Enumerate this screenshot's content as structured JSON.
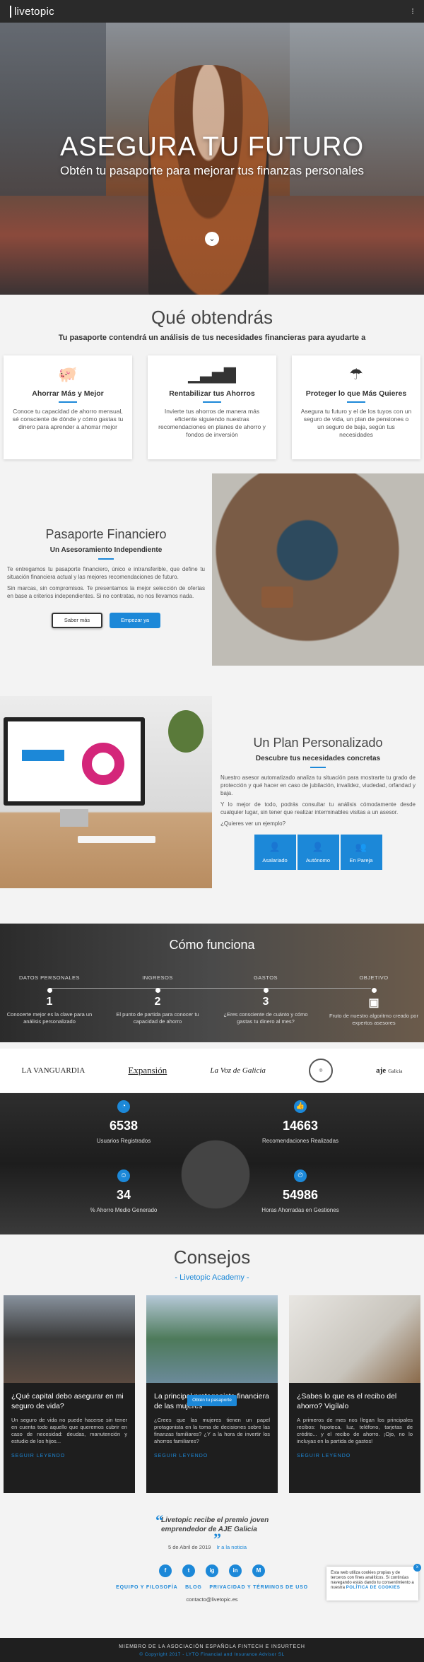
{
  "nav": {
    "logo": "livetopic",
    "menu_icon": "menu-icon"
  },
  "hero": {
    "title": "ASEGURA TU FUTURO",
    "subtitle": "Obtén tu pasaporte para mejorar tus finanzas personales"
  },
  "benefits": {
    "title": "Qué obtendrás",
    "subtitle": "Tu pasaporte contendrá un análisis de tus necesidades financieras para ayudarte a",
    "cards": [
      {
        "icon": "piggy-bank-icon",
        "title": "Ahorrar Más y Mejor",
        "text": "Conoce tu capacidad de ahorro mensual, sé consciente de dónde y cómo gastas tu dinero para aprender a ahorrar mejor"
      },
      {
        "icon": "bar-chart-icon",
        "title": "Rentabilizar tus Ahorros",
        "text": "Invierte tus ahorros de manera más eficiente siguiendo nuestras recomendaciones en planes de ahorro y fondos de inversión"
      },
      {
        "icon": "umbrella-icon",
        "title": "Proteger lo que Más Quieres",
        "text": "Asegura tu futuro y el de los tuyos con un seguro de vida, un plan de pensiones o un seguro de baja, según tus necesidades"
      }
    ]
  },
  "passport": {
    "title": "Pasaporte Financiero",
    "subtitle": "Un Asesoramiento Independiente",
    "p1": "Te entregamos tu pasaporte financiero, único e intransferible, que define tu situación financiera actual y las mejores recomendaciones de futuro.",
    "p2": "Sin marcas, sin compromisos. Te presentamos la mejor selección de ofertas en base a criterios independientes. Si no contratas, no nos llevamos nada.",
    "btn_more": "Saber más",
    "btn_start": "Empezar ya"
  },
  "plan": {
    "title": "Un Plan Personalizado",
    "subtitle": "Descubre tus necesidades concretas",
    "p1": "Nuestro asesor automatizado analiza tu situación para mostrarte tu grado de protección y qué hacer en caso de jubilación, invalidez, viudedad, orfandad y baja.",
    "p2": "Y lo mejor de todo, podrás consultar tu análisis cómodamente desde cualquier lugar, sin tener que realizar interminables visitas a un asesor.",
    "question": "¿Quieres ver un ejemplo?",
    "examples": [
      {
        "icon": "briefcase-icon",
        "label": "Asalariado"
      },
      {
        "icon": "user-tie-icon",
        "label": "Autónomo"
      },
      {
        "icon": "couple-icon",
        "label": "En Pareja"
      }
    ]
  },
  "how": {
    "title": "Cómo funciona",
    "steps": [
      {
        "label": "DATOS PERSONALES",
        "num": "1",
        "desc": "Conocerte mejor es la clave para un análisis personalizado"
      },
      {
        "label": "INGRESOS",
        "num": "2",
        "desc": "El punto de partida para conocer tu capacidad de ahorro"
      },
      {
        "label": "GASTOS",
        "num": "3",
        "desc": "¿Eres consciente de cuánto y cómo gastas tu dinero al mes?"
      },
      {
        "label": "OBJETIVO",
        "num": "",
        "desc": "Fruto de nuestro algoritmo creado por expertos asesores"
      }
    ]
  },
  "press": {
    "logos": [
      "LA VANGUARDIA",
      "Expansión",
      "La Voz de Galicia",
      "aje"
    ],
    "aje_sub": "Galicia"
  },
  "stats": [
    {
      "icon": "pie-chart-icon",
      "value": "6538",
      "label": "Usuarios Registrados"
    },
    {
      "icon": "thumbs-up-icon",
      "value": "14663",
      "label": "Recomendaciones Realizadas"
    },
    {
      "icon": "smile-icon",
      "value": "34",
      "label": "% Ahorro Medio Generado"
    },
    {
      "icon": "user-clock-icon",
      "value": "54986",
      "label": "Horas Ahorradas en Gestiones"
    }
  ],
  "advice": {
    "title": "Consejos",
    "subtitle": "- Livetopic Academy -",
    "read_more": "SEGUIR LEYENDO",
    "badge": "Obtén tu pasaporte",
    "articles": [
      {
        "title": "¿Qué capital debo asegurar en mi seguro de vida?",
        "text": "Un seguro de vida no puede hacerse sin tener en cuenta todo aquello que queremos cubrir en caso de necesidad: deudas, manutención y estudio de los hijos..."
      },
      {
        "title": "La principal protagonista financiera de las mujeres",
        "text": "¿Crees que las mujeres tienen un papel protagonista en la toma de decisiones sobre las finanzas familiares? ¿Y a la hora de invertir los ahorros familiares?"
      },
      {
        "title": "¿Sabes lo que es el recibo del ahorro? Vigílalo",
        "text": "A primeros de mes nos llegan los principales recibos: hipoteca, luz, teléfono, tarjetas de crédito... y el recibo de ahorro. ¡Ojo, no lo incluyas en la partida de gastos!"
      }
    ]
  },
  "quote": {
    "text": "Livetopic recibe el premio joven emprendedor de AJE Galicia",
    "date": "5 de Abril de 2019",
    "link": "Ir a la noticia"
  },
  "footer": {
    "socials": [
      "f",
      "t",
      "ig",
      "in",
      "M"
    ],
    "links": [
      "EQUIPO Y FILOSOFÍA",
      "BLOG",
      "PRIVACIDAD Y TÉRMINOS DE USO"
    ],
    "email": "contacto@livetopic.es",
    "bottom1": "MIEMBRO DE LA ASOCIACIÓN ESPAÑOLA FINTECH E INSURTECH",
    "bottom2": "© Copyright 2017 - LYTO Financial and Insurance Advisor SL"
  },
  "cookie": {
    "text": "Esta web utiliza cookies propias y de terceros con fines analíticos. Si continúas navegando estás dando tu consentimiento a nuestra",
    "policy": "POLÍTICA DE COOKIES",
    "close": "x"
  }
}
